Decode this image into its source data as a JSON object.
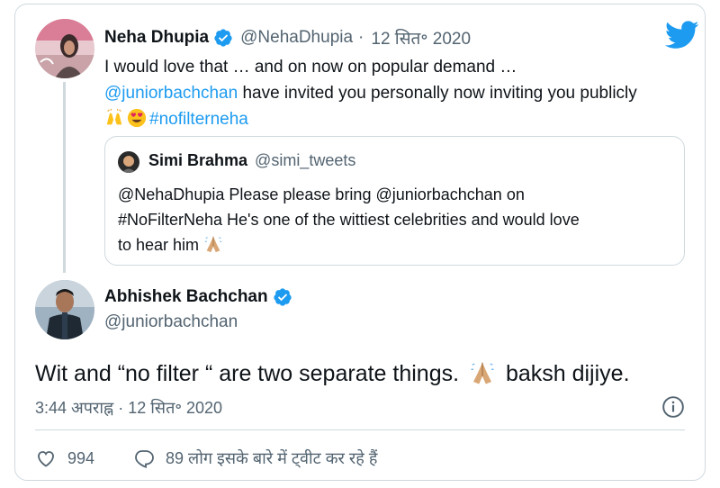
{
  "colors": {
    "accent": "#1d9bf0",
    "text": "#0f1419",
    "secondary": "#536471",
    "border": "#cfd9de"
  },
  "parent_tweet": {
    "author_name": "Neha Dhupia",
    "handle": "@NehaDhupia",
    "separator": "·",
    "date": "12 सित॰ 2020",
    "text_part1": "I would love that … and on now on popular demand …",
    "mention": "@juniorbachchan",
    "text_part2": " have invited you personally now inviting you publicly ",
    "emojis": [
      "raising-hands-emoji",
      "heart-eyes-emoji"
    ],
    "hashtag": "#nofilterneha"
  },
  "quoted_tweet": {
    "author_name": "Simi Brahma",
    "handle": "@simi_tweets",
    "text_line1": "@NehaDhupia Please please bring @juniorbachchan on",
    "text_line2": "#NoFilterNeha He's one of the wittiest celebrities and would love",
    "text_line3": "to hear him ",
    "emoji": "folded-hands-emoji"
  },
  "main_tweet": {
    "author_name": "Abhishek Bachchan",
    "handle": "@juniorbachchan",
    "text_before": "Wit and “no filter “ are two separate things. ",
    "emoji": "folded-hands-emoji",
    "text_after": " baksh dijiye.",
    "timestamp": "3:44 अपराह्न · 12 सित॰ 2020"
  },
  "actions": {
    "likes": "994",
    "replies_text": "89 लोग इसके बारे में ट्वीट कर रहे हैं"
  },
  "icons": [
    "twitter-logo-icon",
    "verified-badge-icon",
    "info-icon",
    "heart-icon",
    "reply-bubble-icon"
  ]
}
